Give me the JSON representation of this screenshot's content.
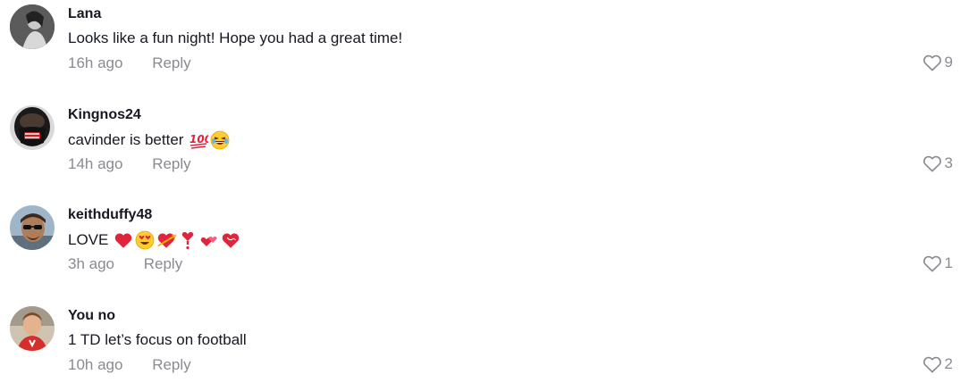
{
  "comments": [
    {
      "username": "Lana",
      "text": "Looks like a fun night! Hope you had a great time!",
      "emojis": [],
      "time": "16h ago",
      "reply_label": "Reply",
      "likes": "9"
    },
    {
      "username": "Kingnos24",
      "text": "cavinder is better",
      "emojis": [
        "hundred-points-emoji",
        "laughing-emoji"
      ],
      "time": "14h ago",
      "reply_label": "Reply",
      "likes": "3"
    },
    {
      "username": "keithduffy48",
      "text": "LOVE",
      "emojis": [
        "red-heart-emoji",
        "heart-eyes-emoji",
        "heart-with-arrow-emoji",
        "heart-exclamation-emoji",
        "two-hearts-emoji",
        "revolving-hearts-emoji"
      ],
      "time": "3h ago",
      "reply_label": "Reply",
      "likes": "1"
    },
    {
      "username": "You no",
      "text": "1 TD let’s focus on football",
      "emojis": [],
      "time": "10h ago",
      "reply_label": "Reply",
      "likes": "2"
    }
  ],
  "colors": {
    "primary_text": "#161823",
    "secondary_text": "#8a8b91",
    "heart_outline": "#8a8b91"
  },
  "icons": {
    "like": "heart-outline-icon"
  }
}
